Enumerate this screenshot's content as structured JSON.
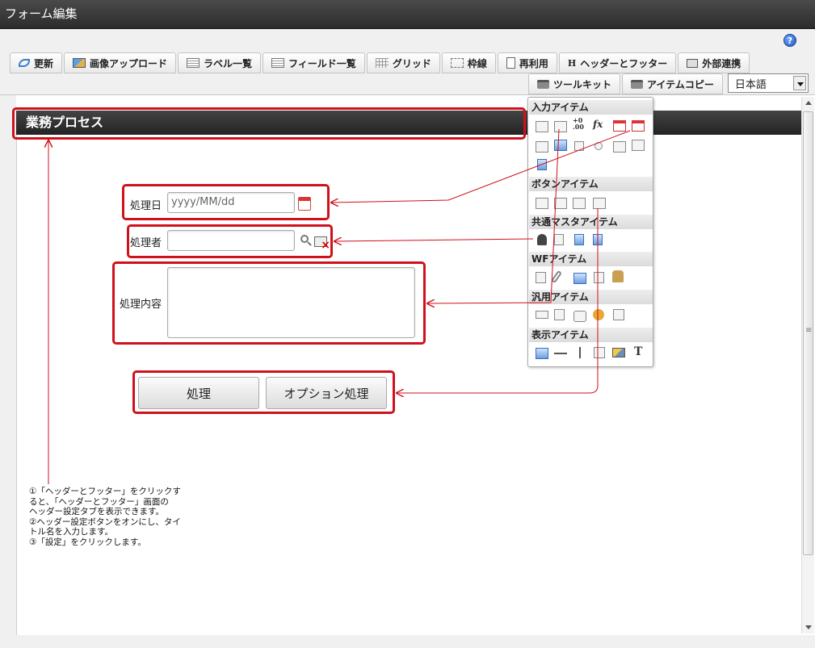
{
  "window": {
    "title": "フォーム編集"
  },
  "help": {
    "icon_label": "?"
  },
  "toolbar": {
    "row1": [
      {
        "name": "refresh-button",
        "icon": "refresh-icon",
        "label": "更新"
      },
      {
        "name": "image-upload-button",
        "icon": "image-upload-icon",
        "label": "画像アップロード"
      },
      {
        "name": "label-list-button",
        "icon": "list-icon",
        "label": "ラベル一覧"
      },
      {
        "name": "field-list-button",
        "icon": "list-icon",
        "label": "フィールド一覧"
      },
      {
        "name": "grid-button",
        "icon": "grid-icon",
        "label": "グリッド"
      },
      {
        "name": "border-button",
        "icon": "border-icon",
        "label": "枠線"
      },
      {
        "name": "reuse-button",
        "icon": "document-icon",
        "label": "再利用"
      },
      {
        "name": "header-footer-button",
        "icon": "h-icon",
        "icon_text": "H",
        "label": "ヘッダーとフッター"
      },
      {
        "name": "external-link-button",
        "icon": "share-icon",
        "label": "外部連携"
      }
    ],
    "row2": [
      {
        "name": "toolkit-button",
        "icon": "toolbox-icon",
        "label": "ツールキット"
      },
      {
        "name": "item-copy-button",
        "icon": "toolbox-icon",
        "label": "アイテムコピー"
      }
    ],
    "language": {
      "selected": "日本語"
    }
  },
  "form": {
    "header_title": "業務プロセス",
    "fields": {
      "date_label": "処理日",
      "date_placeholder": "yyyy/MM/dd",
      "user_label": "処理者",
      "content_label": "処理内容"
    },
    "buttons": {
      "process": "処理",
      "option_process": "オプション処理"
    }
  },
  "palette": {
    "sections": {
      "input": "入力アイテム",
      "button": "ボタンアイテム",
      "master": "共通マスタアイテム",
      "wf": "WFアイテム",
      "general": "汎用アイテム",
      "display": "表示アイテム"
    },
    "icon_texts": {
      "numeric": "+0\n.00",
      "formula": "fx",
      "text": "T"
    }
  },
  "note": {
    "lines": [
      "①「ヘッダーとフッター」をクリックす",
      "ると、「ヘッダーとフッター」画面の",
      "ヘッダー設定タブを表示できます。",
      "②ヘッダー設定ボタンをオンにし、タイ",
      "トル名を入力します。",
      "③「設定」をクリックします。"
    ]
  },
  "colors": {
    "annotation": "#d0101a",
    "header_bg": "#2c2c2c"
  }
}
